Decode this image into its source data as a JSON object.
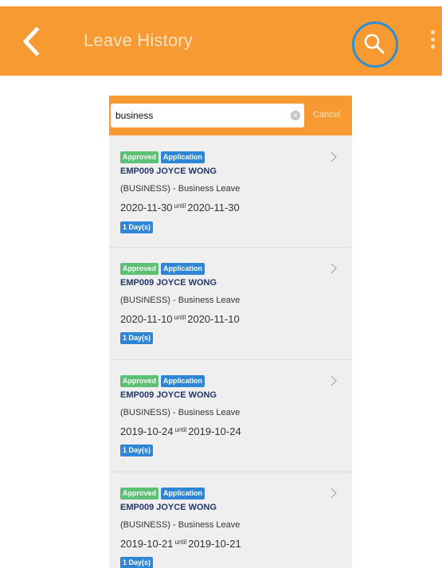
{
  "header": {
    "title": "Leave History",
    "back_icon": "chevron-left-icon",
    "search_icon": "search-icon",
    "more_icon": "more-vertical-icon",
    "accent_color": "#f79a32",
    "highlight_color": "#2f8fd6"
  },
  "search": {
    "value": "business",
    "cancel_label": "Cancel",
    "clear_icon": "clear-icon"
  },
  "items": [
    {
      "status": "Approved",
      "type": "Application",
      "employee": "EMP009 JOYCE WONG",
      "leave": "(BUSINESS) - Business Leave",
      "from": "2020-11-30",
      "until_label": "until",
      "to": "2020-11-30",
      "duration": "1 Day(s)"
    },
    {
      "status": "Approved",
      "type": "Application",
      "employee": "EMP009 JOYCE WONG",
      "leave": "(BUSINESS) - Business Leave",
      "from": "2020-11-10",
      "until_label": "until",
      "to": "2020-11-10",
      "duration": "1 Day(s)"
    },
    {
      "status": "Approved",
      "type": "Application",
      "employee": "EMP009 JOYCE WONG",
      "leave": "(BUSINESS) - Business Leave",
      "from": "2019-10-24",
      "until_label": "until",
      "to": "2019-10-24",
      "duration": "1 Day(s)"
    },
    {
      "status": "Approved",
      "type": "Application",
      "employee": "EMP009 JOYCE WONG",
      "leave": "(BUSINESS) - Business Leave",
      "from": "2019-10-21",
      "until_label": "until",
      "to": "2019-10-21",
      "duration": "1 Day(s)"
    }
  ]
}
